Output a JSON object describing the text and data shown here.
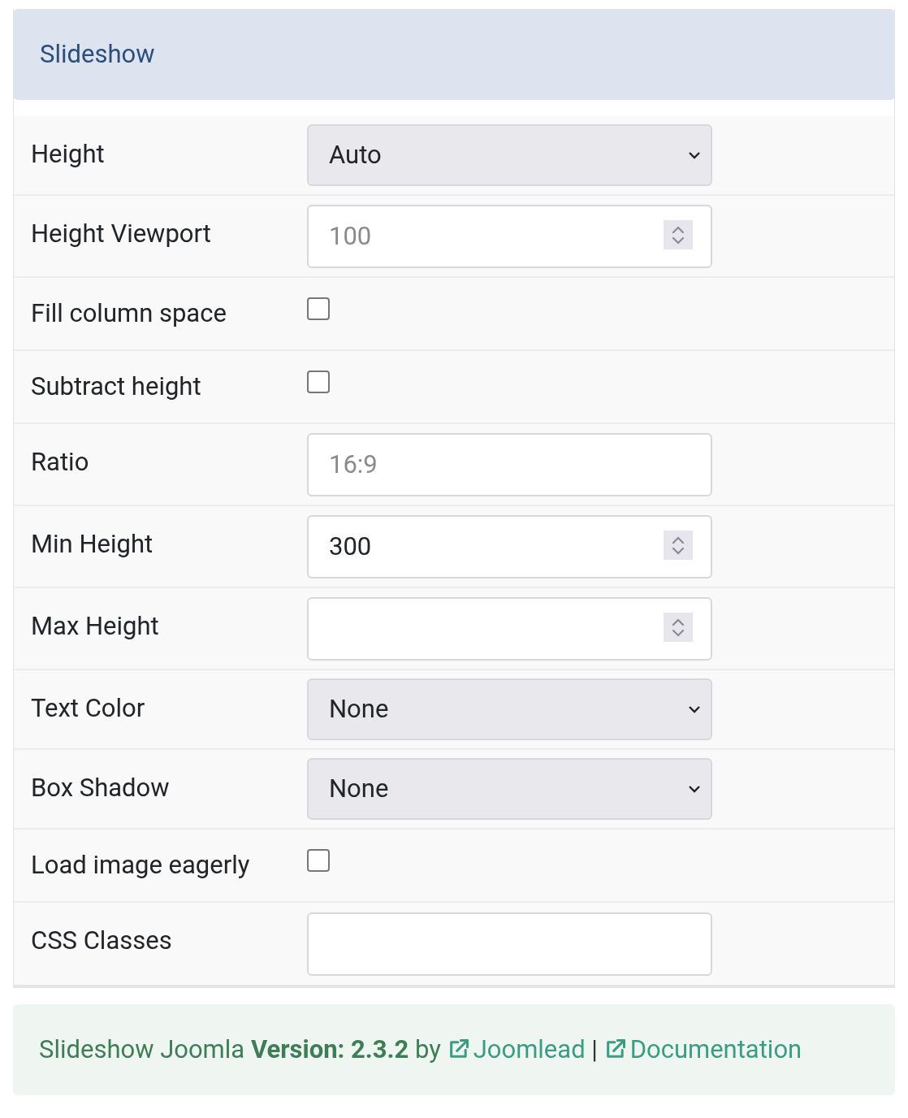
{
  "panel": {
    "title": "Slideshow"
  },
  "fields": [
    {
      "label": "Height",
      "kind": "select",
      "value": "Auto"
    },
    {
      "label": "Height Viewport",
      "kind": "number",
      "placeholder": "100"
    },
    {
      "label": "Fill column space",
      "kind": "checkbox",
      "checked": false
    },
    {
      "label": "Subtract height",
      "kind": "checkbox",
      "checked": false
    },
    {
      "label": "Ratio",
      "kind": "text",
      "placeholder": "16:9"
    },
    {
      "label": "Min Height",
      "kind": "number",
      "value": "300"
    },
    {
      "label": "Max Height",
      "kind": "number"
    },
    {
      "label": "Text Color",
      "kind": "select",
      "value": "None"
    },
    {
      "label": "Box Shadow",
      "kind": "select",
      "value": "None"
    },
    {
      "label": "Load image eagerly",
      "kind": "checkbox",
      "checked": false
    },
    {
      "label": "CSS Classes",
      "kind": "text"
    }
  ],
  "footer": {
    "text": "Slideshow Joomla **Version: 2.3.2** by",
    "links": [
      "Joomlead",
      "Documentation"
    ],
    "separator": "|"
  }
}
